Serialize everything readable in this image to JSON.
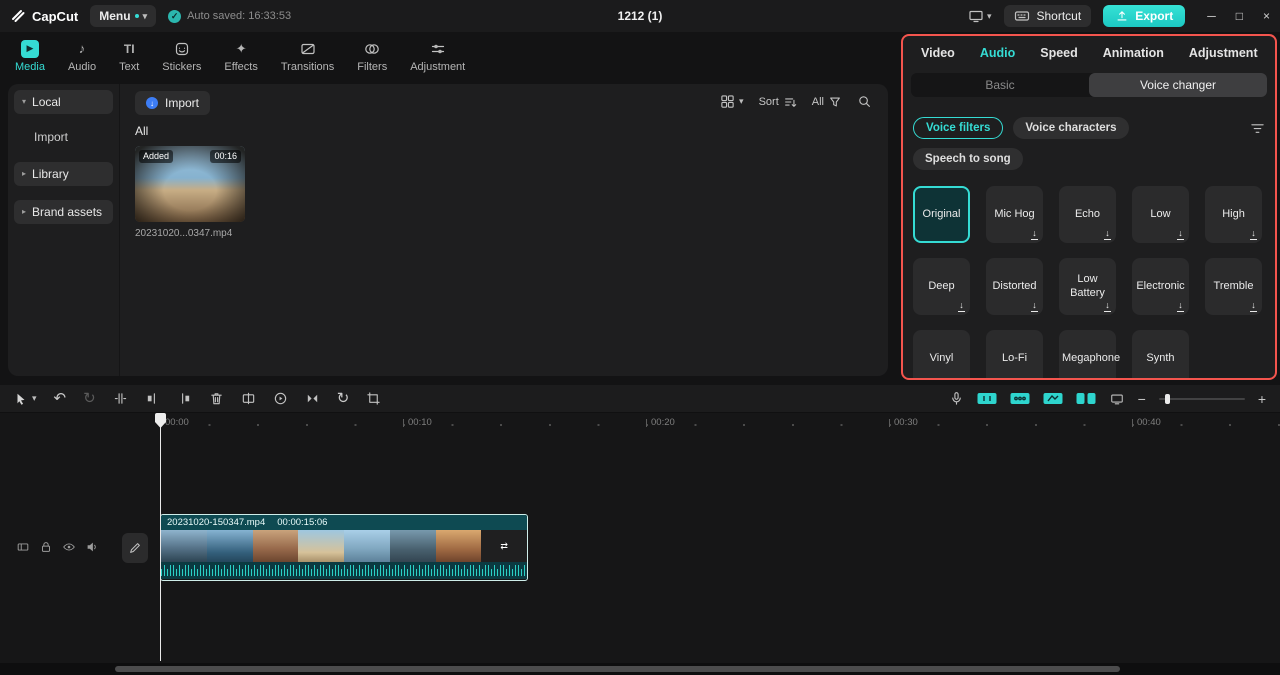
{
  "titlebar": {
    "app_name": "CapCut",
    "menu_label": "Menu",
    "autosave_text": "Auto saved: 16:33:53",
    "project_title": "1212 (1)",
    "shortcut_label": "Shortcut",
    "export_label": "Export"
  },
  "icons": {
    "caret_down": "▾",
    "chevron_right": "▸",
    "chevron_down": "▾",
    "undo": "↶",
    "rotate": "↻",
    "check": "✓",
    "minus": "−",
    "plus": "+",
    "minimize": "─",
    "maximize": "□",
    "close": "×",
    "note": "♪",
    "sparkle": "✦",
    "text_tool": "TI",
    "play": "▶",
    "download": "↓",
    "import_arrow": "↓",
    "media_end": "⇄"
  },
  "ribbon": {
    "tabs": [
      {
        "label": "Media"
      },
      {
        "label": "Audio"
      },
      {
        "label": "Text"
      },
      {
        "label": "Stickers"
      },
      {
        "label": "Effects"
      },
      {
        "label": "Transitions"
      },
      {
        "label": "Filters"
      },
      {
        "label": "Adjustment"
      }
    ]
  },
  "sidebar": {
    "items": [
      {
        "label": "Local"
      },
      {
        "label": "Import"
      },
      {
        "label": "Library"
      },
      {
        "label": "Brand assets"
      }
    ]
  },
  "media": {
    "import_button": "Import",
    "section_label": "All",
    "sort_label": "Sort",
    "filter_label": "All",
    "clip": {
      "badge": "Added",
      "duration": "00:16",
      "filename": "20231020...0347.mp4"
    }
  },
  "inspector": {
    "tabs": [
      {
        "label": "Video"
      },
      {
        "label": "Audio"
      },
      {
        "label": "Speed"
      },
      {
        "label": "Animation"
      },
      {
        "label": "Adjustment"
      }
    ],
    "subtabs": [
      {
        "label": "Basic"
      },
      {
        "label": "Voice changer"
      }
    ],
    "pills": [
      {
        "label": "Voice filters"
      },
      {
        "label": "Voice characters"
      },
      {
        "label": "Speech to song"
      }
    ],
    "voices": [
      {
        "label": "Original"
      },
      {
        "label": "Mic Hog"
      },
      {
        "label": "Echo"
      },
      {
        "label": "Low"
      },
      {
        "label": "High"
      },
      {
        "label": "Deep"
      },
      {
        "label": "Distorted"
      },
      {
        "label": "Low Battery"
      },
      {
        "label": "Electronic"
      },
      {
        "label": "Tremble"
      },
      {
        "label": "Vinyl"
      },
      {
        "label": "Lo-Fi"
      },
      {
        "label": "Megaphone"
      },
      {
        "label": "Synth"
      }
    ]
  },
  "timeline": {
    "ruler": [
      "00:00",
      "00:10",
      "00:20",
      "00:30",
      "00:40"
    ],
    "clip_name": "20231020-150347.mp4",
    "clip_duration": "00:00:15:06"
  },
  "colors": {
    "accent": "#35dcd4",
    "highlight_border": "#f4554e"
  }
}
